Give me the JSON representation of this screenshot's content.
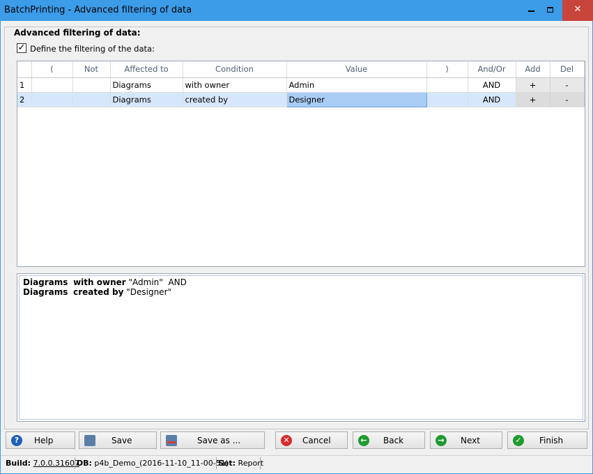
{
  "window": {
    "title": "BatchPrinting - Advanced filtering of data",
    "minimize_glyph": "",
    "maximize_glyph": "",
    "close_glyph": "✕"
  },
  "group": {
    "title": "Advanced filtering of data:",
    "checkbox_label": "Define the filtering of the data:",
    "checkbox_checked": true,
    "checkbox_glyph": "✓"
  },
  "grid": {
    "columns": [
      "",
      "(",
      "Not",
      "Affected to",
      "Condition",
      "Value",
      ")",
      "And/Or",
      "Add",
      "Del"
    ],
    "rows": [
      {
        "no": "1",
        "open": "",
        "not": "",
        "affected": "Diagrams",
        "condition": "with owner",
        "value": "Admin",
        "close": "",
        "andor": "AND",
        "add": "+",
        "del": "-"
      },
      {
        "no": "2",
        "open": "",
        "not": "",
        "affected": "Diagrams",
        "condition": "created by",
        "value": "Designer",
        "close": "",
        "andor": "AND",
        "add": "+",
        "del": "-"
      }
    ]
  },
  "preview": {
    "lines": [
      {
        "subject": "Diagrams",
        "verb": "with owner",
        "value": "\"Admin\"",
        "conj": "AND"
      },
      {
        "subject": "Diagrams",
        "verb": "created by",
        "value": "\"Designer\"",
        "conj": ""
      }
    ]
  },
  "buttons": {
    "help": "Help",
    "save": "Save",
    "save_as": "Save as ...",
    "cancel": "Cancel",
    "back": "Back",
    "next": "Next",
    "finish": "Finish"
  },
  "status": {
    "build_label": "Build:",
    "build_value": "7.0.0.31607",
    "db_label": "DB:",
    "db_value": "p4b_Demo_(2016-11-10_11-00-51)",
    "set_label": "Set:",
    "set_value": "Report"
  },
  "colors": {
    "titlebar": "#3c9ce8",
    "close_button": "#c8453b",
    "selected_row": "#d6e7fb",
    "selected_cell": "#a9cdf5"
  }
}
